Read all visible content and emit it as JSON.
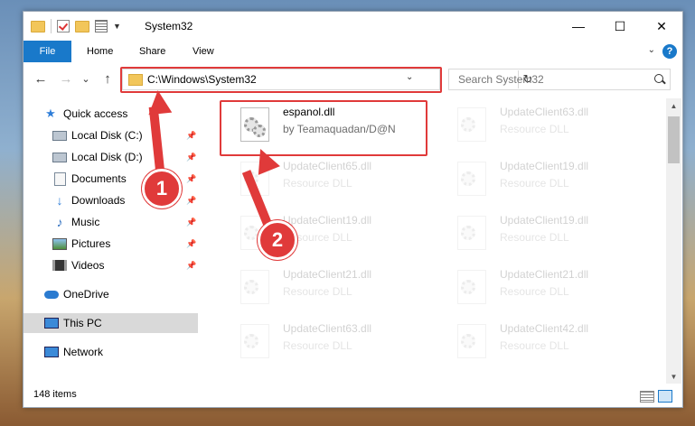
{
  "window": {
    "title": "System32"
  },
  "controls": {
    "minimize": "—",
    "maximize": "☐",
    "close": "✕"
  },
  "ribbon": {
    "tabs": [
      "File",
      "Home",
      "Share",
      "View"
    ],
    "help": "?"
  },
  "nav": {
    "back": "←",
    "forward": "→",
    "recent": "⌄",
    "up": "↑",
    "address": "C:\\Windows\\System32",
    "refresh": "↻"
  },
  "search": {
    "placeholder": "Search System32"
  },
  "sidebar": {
    "items": [
      {
        "label": "Quick access"
      },
      {
        "label": "Local Disk (C:)"
      },
      {
        "label": "Local Disk (D:)"
      },
      {
        "label": "Documents"
      },
      {
        "label": "Downloads"
      },
      {
        "label": "Music"
      },
      {
        "label": "Pictures"
      },
      {
        "label": "Videos"
      },
      {
        "label": "OneDrive"
      },
      {
        "label": "This PC"
      },
      {
        "label": "Network"
      }
    ]
  },
  "files": [
    {
      "name": "espanol.dll",
      "desc": "by Teamaquadan/D@N"
    },
    {
      "name": "UpdateClient63.dll",
      "desc": "Resource DLL"
    },
    {
      "name": "UpdateClient65.dll",
      "desc": "Resource DLL"
    },
    {
      "name": "UpdateClient19.dll",
      "desc": "Resource DLL"
    },
    {
      "name": "UpdateClient19.dll",
      "desc": "Resource DLL"
    },
    {
      "name": "UpdateClient19.dll",
      "desc": "Resource DLL"
    },
    {
      "name": "UpdateClient21.dll",
      "desc": "Resource DLL"
    },
    {
      "name": "UpdateClient21.dll",
      "desc": "Resource DLL"
    },
    {
      "name": "UpdateClient63.dll",
      "desc": "Resource DLL"
    },
    {
      "name": "UpdateClient42.dll",
      "desc": "Resource DLL"
    }
  ],
  "status": {
    "count": "148 items"
  },
  "annotations": {
    "step1": "1",
    "step2": "2"
  },
  "colors": {
    "accent": "#1979ca",
    "highlight": "#e03a3a"
  }
}
